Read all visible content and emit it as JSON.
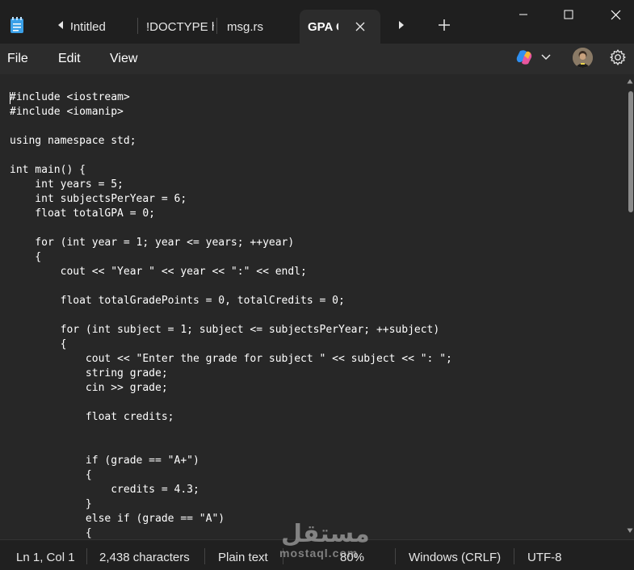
{
  "tabs": [
    {
      "label": "Untitled"
    },
    {
      "label": "!DOCTYPE html"
    },
    {
      "label": "msg.rs"
    },
    {
      "label": "GPA Calculator"
    }
  ],
  "icons": {
    "app": "notepad-icon",
    "tab_scroll_left": "caret-left-icon",
    "tab_scroll_right": "caret-right-icon",
    "new_tab": "plus-icon",
    "close_tab": "close-icon",
    "minimize": "minimize-icon",
    "maximize": "maximize-icon",
    "close_window": "close-icon",
    "copilot": "copilot-icon",
    "settings": "gear-icon"
  },
  "menu": {
    "file": "File",
    "edit": "Edit",
    "view": "View"
  },
  "code_lines": [
    "#include <iostream>",
    "#include <iomanip>",
    "",
    "using namespace std;",
    "",
    "int main() {",
    "    int years = 5;",
    "    int subjectsPerYear = 6;",
    "    float totalGPA = 0;",
    "",
    "    for (int year = 1; year <= years; ++year)",
    "    {",
    "        cout << \"Year \" << year << \":\" << endl;",
    "",
    "        float totalGradePoints = 0, totalCredits = 0;",
    "",
    "        for (int subject = 1; subject <= subjectsPerYear; ++subject)",
    "        {",
    "            cout << \"Enter the grade for subject \" << subject << \": \";",
    "            string grade;",
    "            cin >> grade;",
    "",
    "            float credits;",
    "",
    "",
    "            if (grade == \"A+\")",
    "            {",
    "                credits = 4.3;",
    "            }",
    "            else if (grade == \"A\")",
    "            {"
  ],
  "status": {
    "position": "Ln 1, Col 1",
    "characters": "2,438 characters",
    "format": "Plain text",
    "zoom": "80%",
    "line_ending": "Windows (CRLF)",
    "encoding": "UTF-8"
  },
  "watermark": {
    "arabic": "مستقل",
    "latin": "mostaql.com"
  },
  "colors": {
    "background": "#272727",
    "titlebar": "#1f1f1f",
    "menubar": "#2c2c2c",
    "statusbar": "#202020",
    "text": "#ffffff"
  }
}
